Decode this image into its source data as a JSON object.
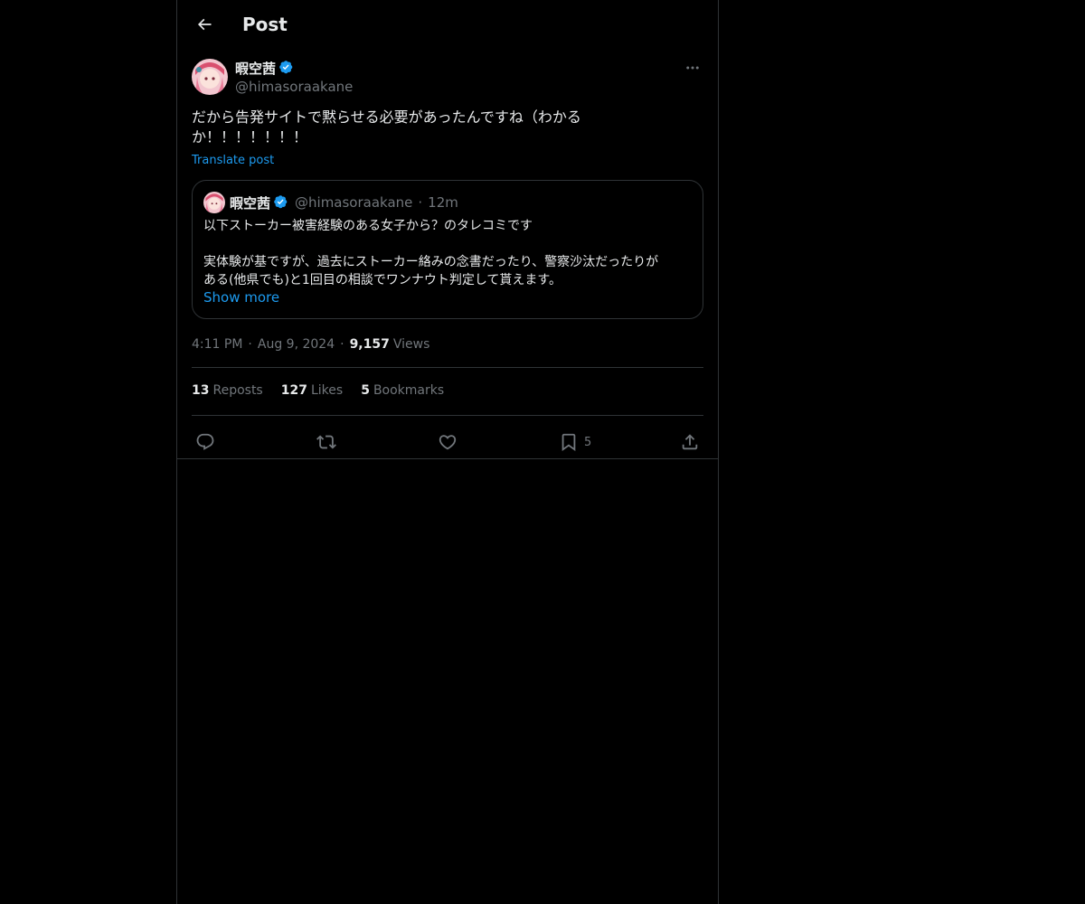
{
  "header": {
    "title": "Post",
    "back_icon": "arrow-left-icon"
  },
  "post": {
    "author": {
      "name": "暇空茜",
      "handle": "@himasoraakane",
      "verified": true,
      "verified_color": "#1d9bf0"
    },
    "text": "だから告発サイトで黙らせる必要があったんですね（わかる\nか！！！！！！！",
    "translate_label": "Translate post",
    "quote": {
      "author_name": "暇空茜",
      "author_handle": "@himasoraakane",
      "dot": "·",
      "time": "12m",
      "line1": "以下ストーカー被害経験のある女子から？のタレコミです",
      "line2": "実体験が基ですが、過去にストーカー絡みの念書だったり、警察沙汰だったりが",
      "line3": "ある(他県でも)と1回目の相談でワンナウト判定して貰えます。",
      "show_more": "Show more"
    },
    "meta": {
      "time": "4:11 PM",
      "sep": "·",
      "date": "Aug 9, 2024",
      "views_count": "9,157",
      "views_label": "Views"
    },
    "stats": [
      {
        "count": "13",
        "label": "Reposts"
      },
      {
        "count": "127",
        "label": "Likes"
      },
      {
        "count": "5",
        "label": "Bookmarks"
      }
    ],
    "actions": {
      "reply_icon": "reply-icon",
      "repost_icon": "repost-icon",
      "like_icon": "heart-icon",
      "bookmark_icon": "bookmark-icon",
      "bookmark_count": "5",
      "share_icon": "share-icon"
    }
  },
  "colors": {
    "background": "#000000",
    "text": "#e7e9ea",
    "muted": "#71767b",
    "accent": "#1d9bf0",
    "border": "#2f3336"
  }
}
